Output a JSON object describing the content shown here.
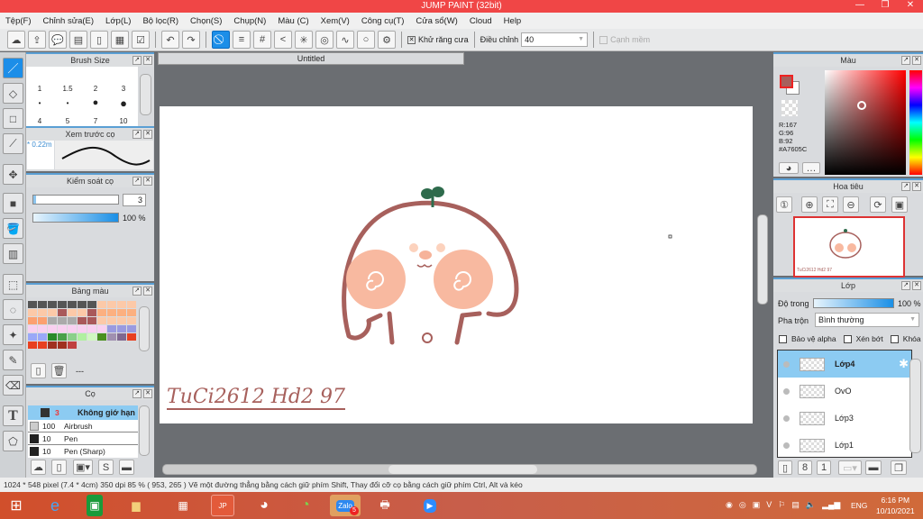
{
  "window": {
    "title": "JUMP PAINT (32bit)",
    "controls": [
      "—",
      "❐",
      "✕"
    ]
  },
  "menu": [
    "Tệp(F)",
    "Chỉnh sửa(E)",
    "Lớp(L)",
    "Bộ lọc(R)",
    "Chọn(S)",
    "Chụp(N)",
    "Màu (C)",
    "Xem(V)",
    "Công cụ(T)",
    "Cửa sổ(W)",
    "Cloud",
    "Help"
  ],
  "toolbar": {
    "antialias_label": "Khử răng cưa",
    "antialias_checked": true,
    "adjust_label": "Điều chỉnh",
    "adjust_value": "40",
    "smooth_label": "Cạnh mềm",
    "smooth_checked": false
  },
  "brush_size": {
    "title": "Brush Size",
    "sizes": [
      "1",
      "1.5",
      "2",
      "3",
      "4",
      "5",
      "7",
      "10"
    ]
  },
  "brush_preview": {
    "title": "Xem trước cọ",
    "size": "* 0.22m"
  },
  "brush_control": {
    "title": "Kiểm soát cọ",
    "size_value": "3",
    "opacity": "100 %",
    "opacity_pct": 100
  },
  "palette": {
    "title": "Bảng màu",
    "label": "---"
  },
  "brushes": {
    "title": "Cọ",
    "items": [
      {
        "size": "3",
        "name": "Không giớ hạn",
        "selected": true,
        "color": "#333333"
      },
      {
        "size": "100",
        "name": "Airbrush",
        "color": "#cccccc"
      },
      {
        "size": "10",
        "name": "Pen",
        "color": "#222222"
      },
      {
        "size": "10",
        "name": "Pen (Sharp)",
        "color": "#222222"
      }
    ]
  },
  "document": {
    "tab": "Untitled",
    "signature": "TuCi2612  Hd2 97"
  },
  "color_panel": {
    "title": "Màu",
    "r": "R:167",
    "g": "G:96",
    "b": "B:92",
    "hex": "#A7605C",
    "fg": "#A7605C",
    "bg": "#FFFFFF"
  },
  "navigator": {
    "title": "Hoa tiêu",
    "thumb_signature": "TuCi2612 Hd2 97"
  },
  "layers": {
    "title": "Lớp",
    "opacity_label": "Độ trong",
    "opacity": "100 %",
    "opacity_pct": 100,
    "blend_label": "Pha trộn",
    "blend_value": "Bình thường",
    "protect_alpha": "Bảo vệ alpha",
    "clip": "Xén bớt",
    "lock": "Khóa",
    "items": [
      {
        "name": "Lớp4",
        "selected": true
      },
      {
        "name": "OvO"
      },
      {
        "name": "Lớp3"
      },
      {
        "name": "Lớp1"
      }
    ]
  },
  "status": "1024 * 548 pixel   (7.4 * 4cm)   350 dpi   85 %   ( 953, 265 )   Vẽ một đường thẳng bằng cách giữ phím Shift, Thay đổi cỡ cọ bằng cách giữ phím Ctrl, Alt và kéo",
  "taskbar": {
    "lang": "ENG",
    "time": "6:16 PM",
    "date": "10/10/2021",
    "zalo_badge": "5"
  },
  "colors": {
    "titlebar": "#F04646",
    "accent": "#1C8EE8",
    "stroke": "#A7605C",
    "cheek": "#F8B9A0"
  }
}
